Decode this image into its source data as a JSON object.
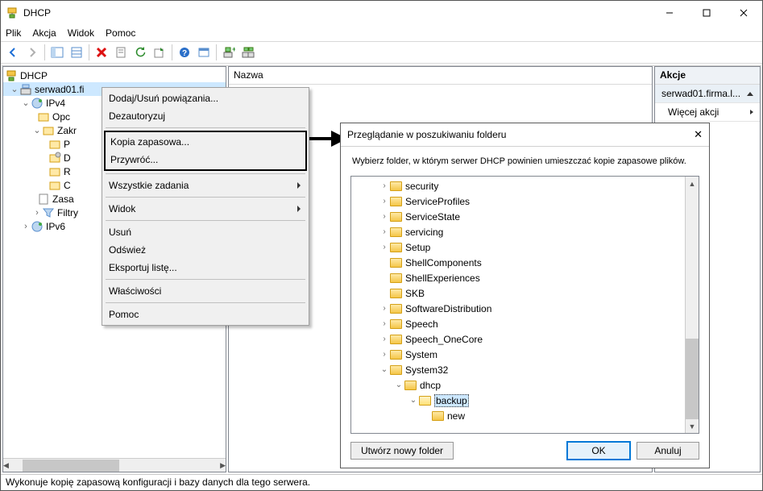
{
  "window_title": "DHCP",
  "menubar": [
    "Plik",
    "Akcja",
    "Widok",
    "Pomoc"
  ],
  "tree": {
    "root": "DHCP",
    "server": "serwad01.fi",
    "ipv4": "IPv4",
    "ipv6": "IPv6",
    "opc": "Opc",
    "zakn": "Zakr",
    "zas": "Zasa",
    "filtr": "Filtry",
    "p": "P",
    "d": "D",
    "r": "R",
    "c": "C"
  },
  "name_header": "Nazwa",
  "actions": {
    "title": "Akcje",
    "server": "serwad01.firma.l...",
    "more": "Więcej akcji"
  },
  "context": [
    "Dodaj/Usuń powiązania...",
    "Dezautoryzuj",
    "Kopia zapasowa...",
    "Przywróć...",
    "Wszystkie zadania",
    "Widok",
    "Usuń",
    "Odśwież",
    "Eksportuj listę...",
    "Właściwości",
    "Pomoc"
  ],
  "dialog": {
    "title": "Przeglądanie w poszukiwaniu folderu",
    "instr": "Wybierz folder, w którym serwer DHCP powinien umieszczać kopie zapasowe plików.",
    "folders": [
      "security",
      "ServiceProfiles",
      "ServiceState",
      "servicing",
      "Setup",
      "ShellComponents",
      "ShellExperiences",
      "SKB",
      "SoftwareDistribution",
      "Speech",
      "Speech_OneCore",
      "System",
      "System32"
    ],
    "sub1": "dhcp",
    "sub2": "backup",
    "sub3": "new",
    "newfolder": "Utwórz nowy folder",
    "ok": "OK",
    "cancel": "Anuluj"
  },
  "status": "Wykonuje kopię zapasową konfiguracji i bazy danych dla tego serwera."
}
